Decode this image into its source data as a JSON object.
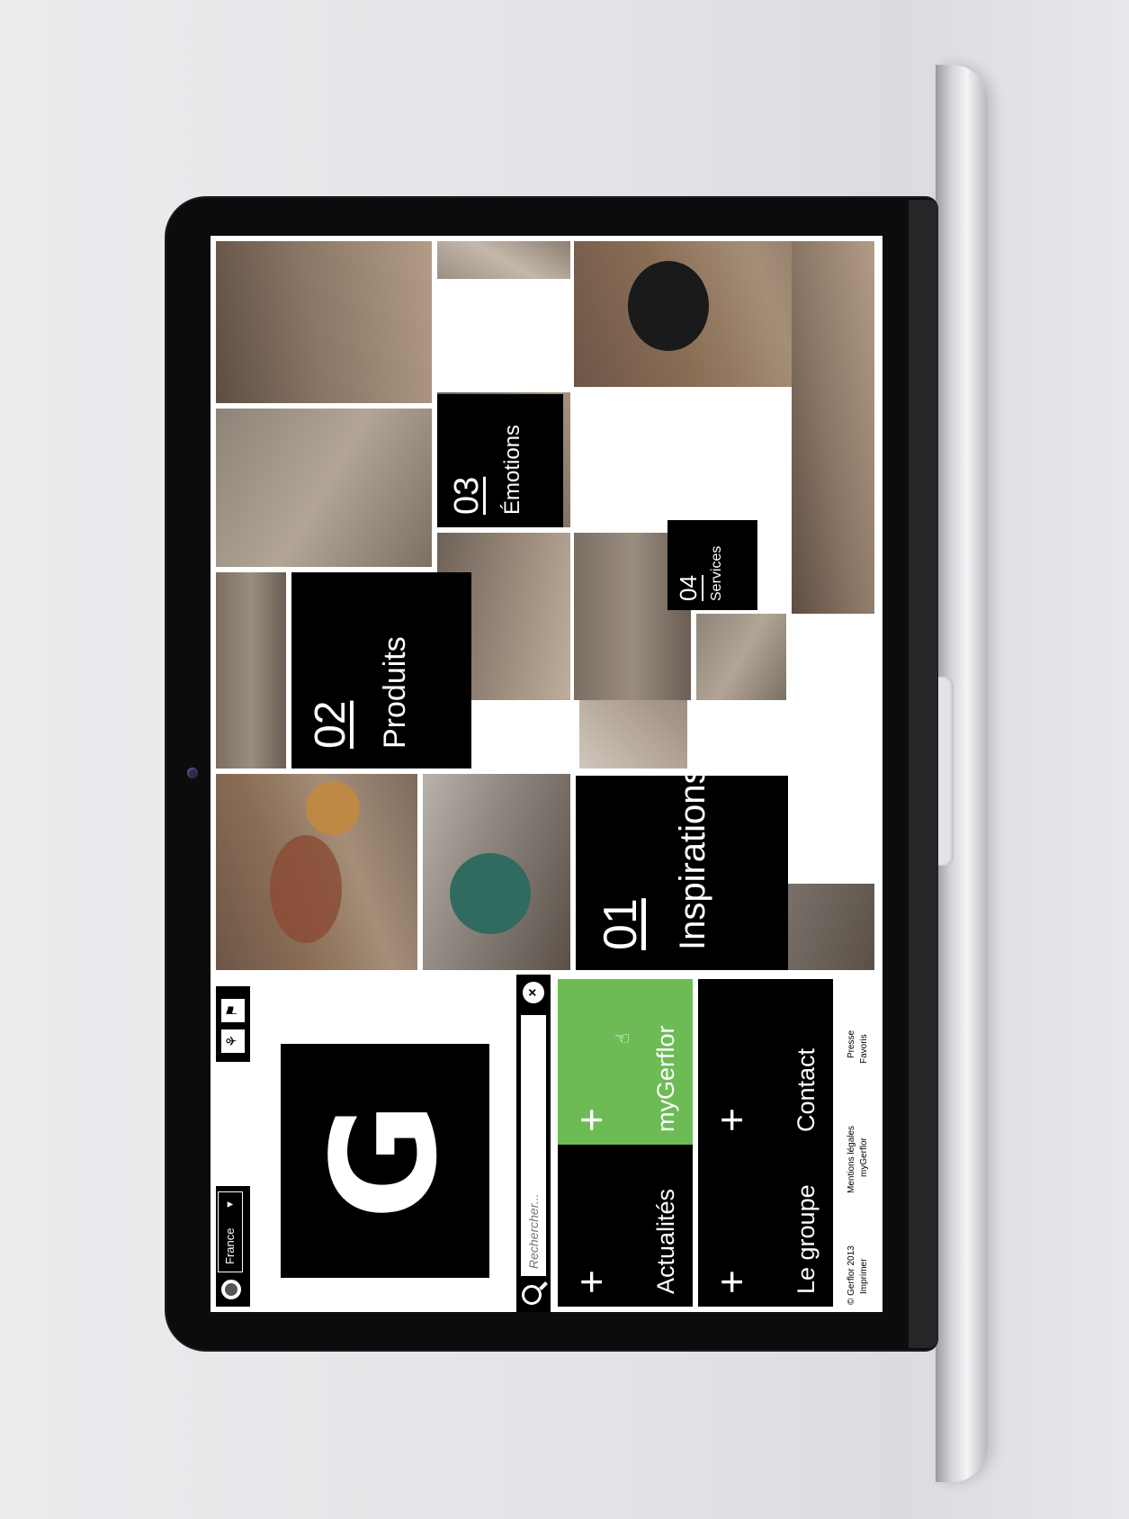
{
  "site": {
    "country": "France",
    "logo_letter": "G",
    "search": {
      "placeholder": "Rechercher..."
    },
    "menu": [
      {
        "label": "Actualités"
      },
      {
        "label": "myGerflor"
      },
      {
        "label": "Le groupe"
      },
      {
        "label": "Contact"
      }
    ],
    "footer": {
      "col1": [
        "© Gerflor 2013",
        "Imprimer"
      ],
      "col2": [
        "Mentions légales",
        "myGerflor"
      ],
      "col3": [
        "Presse",
        "Favoris"
      ]
    },
    "tiles": {
      "inspirations": {
        "num": "01",
        "label": "Inspirations"
      },
      "produits": {
        "num": "02",
        "label": "Produits"
      },
      "emotions": {
        "num": "03",
        "label": "Émotions"
      },
      "services": {
        "num": "04",
        "label": "Services"
      }
    }
  },
  "colors": {
    "accent_green": "#6dbb55",
    "tile_black": "#000000"
  }
}
